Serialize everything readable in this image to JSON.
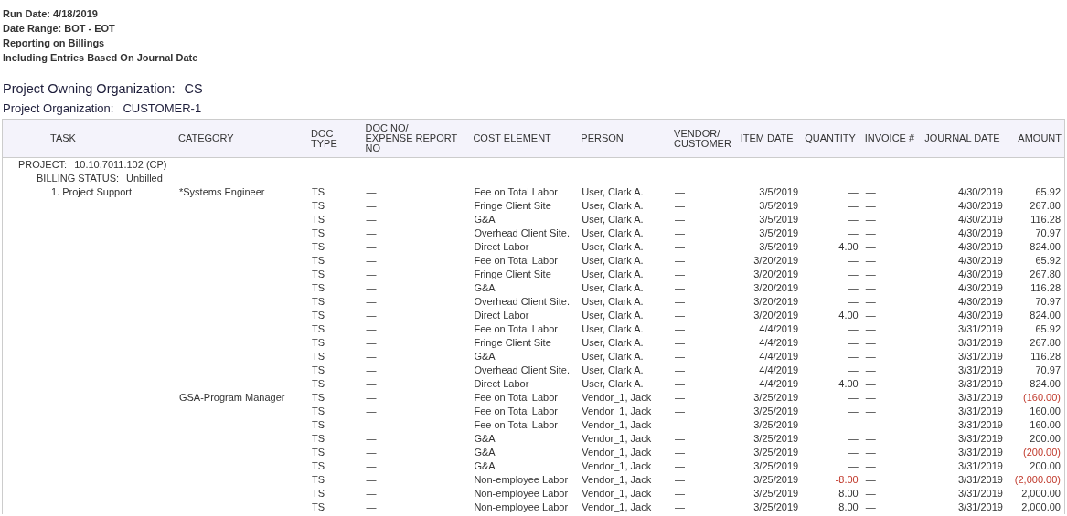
{
  "report_info": [
    "Run Date: 4/18/2019",
    "Date Range: BOT - EOT",
    "Reporting on Billings",
    "Including Entries Based On Journal Date"
  ],
  "owning_org": {
    "label": "Project Owning Organization:",
    "value": "CS"
  },
  "project_org": {
    "label": "Project Organization:",
    "value": "CUSTOMER-1"
  },
  "table": {
    "columns": [
      "TASK",
      "CATEGORY",
      "DOC\nTYPE",
      "DOC NO/\nEXPENSE REPORT\nNO",
      "COST ELEMENT",
      "PERSON",
      "VENDOR/\nCUSTOMER",
      "ITEM DATE",
      "QUANTITY",
      "INVOICE #",
      "JOURNAL DATE",
      "AMOUNT"
    ],
    "project": {
      "label": "PROJECT:",
      "value": "10.10.7011.102 (CP)"
    },
    "billing_status": {
      "label": "BILLING STATUS:",
      "value": "Unbilled"
    },
    "rows": [
      {
        "task": "1. Project Support",
        "category": "*Systems Engineer",
        "doc_type": "TS",
        "doc_no": "—",
        "cost_element": "Fee on Total Labor",
        "person": "User, Clark A.",
        "vendor": "—",
        "item_date": "3/5/2019",
        "quantity": "—",
        "invoice": "—",
        "journal_date": "4/30/2019",
        "amount": "65.92",
        "quantity_negative": false,
        "amount_negative": false
      },
      {
        "doc_type": "TS",
        "doc_no": "—",
        "cost_element": "Fringe Client Site",
        "person": "User, Clark A.",
        "vendor": "—",
        "item_date": "3/5/2019",
        "quantity": "—",
        "invoice": "—",
        "journal_date": "4/30/2019",
        "amount": "267.80",
        "quantity_negative": false,
        "amount_negative": false
      },
      {
        "doc_type": "TS",
        "doc_no": "—",
        "cost_element": "G&A",
        "person": "User, Clark A.",
        "vendor": "—",
        "item_date": "3/5/2019",
        "quantity": "—",
        "invoice": "—",
        "journal_date": "4/30/2019",
        "amount": "116.28",
        "quantity_negative": false,
        "amount_negative": false
      },
      {
        "doc_type": "TS",
        "doc_no": "—",
        "cost_element": "Overhead Client Site.",
        "person": "User, Clark A.",
        "vendor": "—",
        "item_date": "3/5/2019",
        "quantity": "—",
        "invoice": "—",
        "journal_date": "4/30/2019",
        "amount": "70.97",
        "quantity_negative": false,
        "amount_negative": false
      },
      {
        "doc_type": "TS",
        "doc_no": "—",
        "cost_element": "Direct Labor",
        "person": "User, Clark A.",
        "vendor": "—",
        "item_date": "3/5/2019",
        "quantity": "4.00",
        "invoice": "—",
        "journal_date": "4/30/2019",
        "amount": "824.00",
        "quantity_negative": false,
        "amount_negative": false
      },
      {
        "doc_type": "TS",
        "doc_no": "—",
        "cost_element": "Fee on Total Labor",
        "person": "User, Clark A.",
        "vendor": "—",
        "item_date": "3/20/2019",
        "quantity": "—",
        "invoice": "—",
        "journal_date": "4/30/2019",
        "amount": "65.92",
        "quantity_negative": false,
        "amount_negative": false
      },
      {
        "doc_type": "TS",
        "doc_no": "—",
        "cost_element": "Fringe Client Site",
        "person": "User, Clark A.",
        "vendor": "—",
        "item_date": "3/20/2019",
        "quantity": "—",
        "invoice": "—",
        "journal_date": "4/30/2019",
        "amount": "267.80",
        "quantity_negative": false,
        "amount_negative": false
      },
      {
        "doc_type": "TS",
        "doc_no": "—",
        "cost_element": "G&A",
        "person": "User, Clark A.",
        "vendor": "—",
        "item_date": "3/20/2019",
        "quantity": "—",
        "invoice": "—",
        "journal_date": "4/30/2019",
        "amount": "116.28",
        "quantity_negative": false,
        "amount_negative": false
      },
      {
        "doc_type": "TS",
        "doc_no": "—",
        "cost_element": "Overhead Client Site.",
        "person": "User, Clark A.",
        "vendor": "—",
        "item_date": "3/20/2019",
        "quantity": "—",
        "invoice": "—",
        "journal_date": "4/30/2019",
        "amount": "70.97",
        "quantity_negative": false,
        "amount_negative": false
      },
      {
        "doc_type": "TS",
        "doc_no": "—",
        "cost_element": "Direct Labor",
        "person": "User, Clark A.",
        "vendor": "—",
        "item_date": "3/20/2019",
        "quantity": "4.00",
        "invoice": "—",
        "journal_date": "4/30/2019",
        "amount": "824.00",
        "quantity_negative": false,
        "amount_negative": false
      },
      {
        "doc_type": "TS",
        "doc_no": "—",
        "cost_element": "Fee on Total Labor",
        "person": "User, Clark A.",
        "vendor": "—",
        "item_date": "4/4/2019",
        "quantity": "—",
        "invoice": "—",
        "journal_date": "3/31/2019",
        "amount": "65.92",
        "quantity_negative": false,
        "amount_negative": false
      },
      {
        "doc_type": "TS",
        "doc_no": "—",
        "cost_element": "Fringe Client Site",
        "person": "User, Clark A.",
        "vendor": "—",
        "item_date": "4/4/2019",
        "quantity": "—",
        "invoice": "—",
        "journal_date": "3/31/2019",
        "amount": "267.80",
        "quantity_negative": false,
        "amount_negative": false
      },
      {
        "doc_type": "TS",
        "doc_no": "—",
        "cost_element": "G&A",
        "person": "User, Clark A.",
        "vendor": "—",
        "item_date": "4/4/2019",
        "quantity": "—",
        "invoice": "—",
        "journal_date": "3/31/2019",
        "amount": "116.28",
        "quantity_negative": false,
        "amount_negative": false
      },
      {
        "doc_type": "TS",
        "doc_no": "—",
        "cost_element": "Overhead Client Site.",
        "person": "User, Clark A.",
        "vendor": "—",
        "item_date": "4/4/2019",
        "quantity": "—",
        "invoice": "—",
        "journal_date": "3/31/2019",
        "amount": "70.97",
        "quantity_negative": false,
        "amount_negative": false
      },
      {
        "doc_type": "TS",
        "doc_no": "—",
        "cost_element": "Direct Labor",
        "person": "User, Clark A.",
        "vendor": "—",
        "item_date": "4/4/2019",
        "quantity": "4.00",
        "invoice": "—",
        "journal_date": "3/31/2019",
        "amount": "824.00",
        "quantity_negative": false,
        "amount_negative": false
      },
      {
        "category": "GSA-Program Manager",
        "doc_type": "TS",
        "doc_no": "—",
        "cost_element": "Fee on Total Labor",
        "person": "Vendor_1, Jack",
        "vendor": "—",
        "item_date": "3/25/2019",
        "quantity": "—",
        "invoice": "—",
        "journal_date": "3/31/2019",
        "amount": "(160.00)",
        "quantity_negative": false,
        "amount_negative": true
      },
      {
        "doc_type": "TS",
        "doc_no": "—",
        "cost_element": "Fee on Total Labor",
        "person": "Vendor_1, Jack",
        "vendor": "—",
        "item_date": "3/25/2019",
        "quantity": "—",
        "invoice": "—",
        "journal_date": "3/31/2019",
        "amount": "160.00",
        "quantity_negative": false,
        "amount_negative": false
      },
      {
        "doc_type": "TS",
        "doc_no": "—",
        "cost_element": "Fee on Total Labor",
        "person": "Vendor_1, Jack",
        "vendor": "—",
        "item_date": "3/25/2019",
        "quantity": "—",
        "invoice": "—",
        "journal_date": "3/31/2019",
        "amount": "160.00",
        "quantity_negative": false,
        "amount_negative": false
      },
      {
        "doc_type": "TS",
        "doc_no": "—",
        "cost_element": "G&A",
        "person": "Vendor_1, Jack",
        "vendor": "—",
        "item_date": "3/25/2019",
        "quantity": "—",
        "invoice": "—",
        "journal_date": "3/31/2019",
        "amount": "200.00",
        "quantity_negative": false,
        "amount_negative": false
      },
      {
        "doc_type": "TS",
        "doc_no": "—",
        "cost_element": "G&A",
        "person": "Vendor_1, Jack",
        "vendor": "—",
        "item_date": "3/25/2019",
        "quantity": "—",
        "invoice": "—",
        "journal_date": "3/31/2019",
        "amount": "(200.00)",
        "quantity_negative": false,
        "amount_negative": true
      },
      {
        "doc_type": "TS",
        "doc_no": "—",
        "cost_element": "G&A",
        "person": "Vendor_1, Jack",
        "vendor": "—",
        "item_date": "3/25/2019",
        "quantity": "—",
        "invoice": "—",
        "journal_date": "3/31/2019",
        "amount": "200.00",
        "quantity_negative": false,
        "amount_negative": false
      },
      {
        "doc_type": "TS",
        "doc_no": "—",
        "cost_element": "Non-employee Labor",
        "person": "Vendor_1, Jack",
        "vendor": "—",
        "item_date": "3/25/2019",
        "quantity": "-8.00",
        "invoice": "—",
        "journal_date": "3/31/2019",
        "amount": "(2,000.00)",
        "quantity_negative": true,
        "amount_negative": true
      },
      {
        "doc_type": "TS",
        "doc_no": "—",
        "cost_element": "Non-employee Labor",
        "person": "Vendor_1, Jack",
        "vendor": "—",
        "item_date": "3/25/2019",
        "quantity": "8.00",
        "invoice": "—",
        "journal_date": "3/31/2019",
        "amount": "2,000.00",
        "quantity_negative": false,
        "amount_negative": false
      },
      {
        "doc_type": "TS",
        "doc_no": "—",
        "cost_element": "Non-employee Labor",
        "person": "Vendor_1, Jack",
        "vendor": "—",
        "item_date": "3/25/2019",
        "quantity": "8.00",
        "invoice": "—",
        "journal_date": "3/31/2019",
        "amount": "2,000.00",
        "quantity_negative": false,
        "amount_negative": false
      }
    ]
  }
}
